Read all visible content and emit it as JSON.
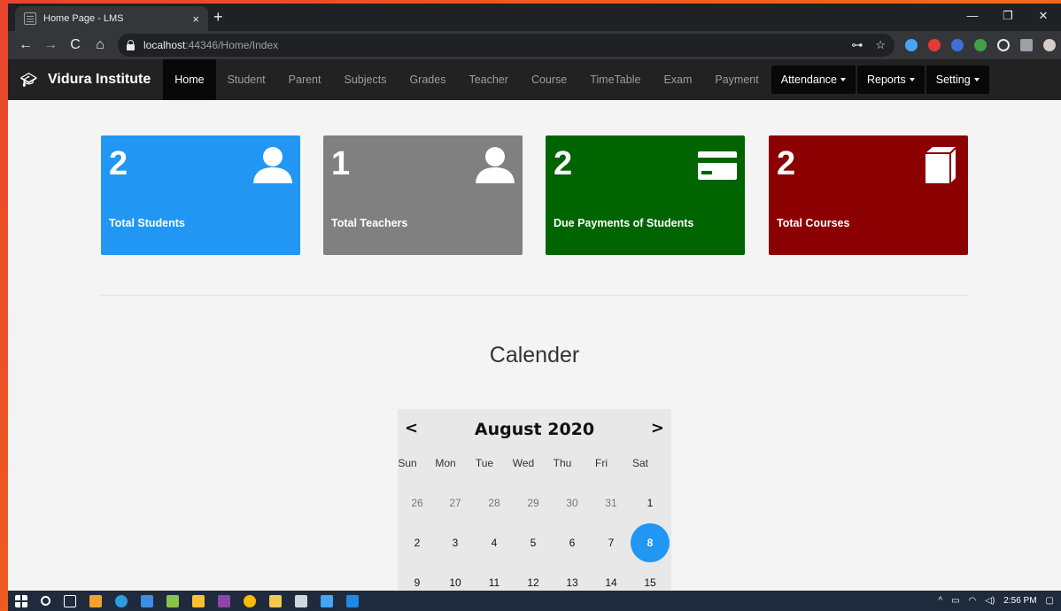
{
  "browser": {
    "tab_title": "Home Page - LMS",
    "tab_close": "×",
    "new_tab": "+",
    "win_minimize": "—",
    "win_restore": "❐",
    "win_close": "✕",
    "back": "←",
    "forward": "→",
    "reload": "C",
    "home": "⌂",
    "url_host": "localhost",
    "url_path": ":44346/Home/Index",
    "key_icon": "⊶",
    "star_icon": "☆"
  },
  "nav": {
    "brand": "Vidura Institute",
    "items": [
      "Home",
      "Student",
      "Parent",
      "Subjects",
      "Grades",
      "Teacher",
      "Course",
      "TimeTable",
      "Exam",
      "Payment"
    ],
    "active": "Home",
    "dropdowns": [
      "Attendance",
      "Reports",
      "Setting"
    ]
  },
  "cards": [
    {
      "value": "2",
      "label": "Total Students",
      "color": "#2196f3",
      "icon": "user-icon"
    },
    {
      "value": "1",
      "label": "Total Teachers",
      "color": "#808080",
      "icon": "user-icon"
    },
    {
      "value": "2",
      "label": "Due Payments of Students",
      "color": "#006400",
      "icon": "credit-card-icon"
    },
    {
      "value": "2",
      "label": "Total Courses",
      "color": "#8b0000",
      "icon": "book-icon"
    }
  ],
  "calendar": {
    "title": "Calender",
    "month": "August 2020",
    "prev": "<",
    "next": ">",
    "weekdays": [
      "Sun",
      "Mon",
      "Tue",
      "Wed",
      "Thu",
      "Fri",
      "Sat"
    ],
    "weeks": [
      [
        "26",
        "27",
        "28",
        "29",
        "30",
        "31",
        "1"
      ],
      [
        "2",
        "3",
        "4",
        "5",
        "6",
        "7",
        "8"
      ],
      [
        "9",
        "10",
        "11",
        "12",
        "13",
        "14",
        "15"
      ]
    ],
    "today": "8"
  },
  "taskbar": {
    "time": "2:56 PM"
  }
}
